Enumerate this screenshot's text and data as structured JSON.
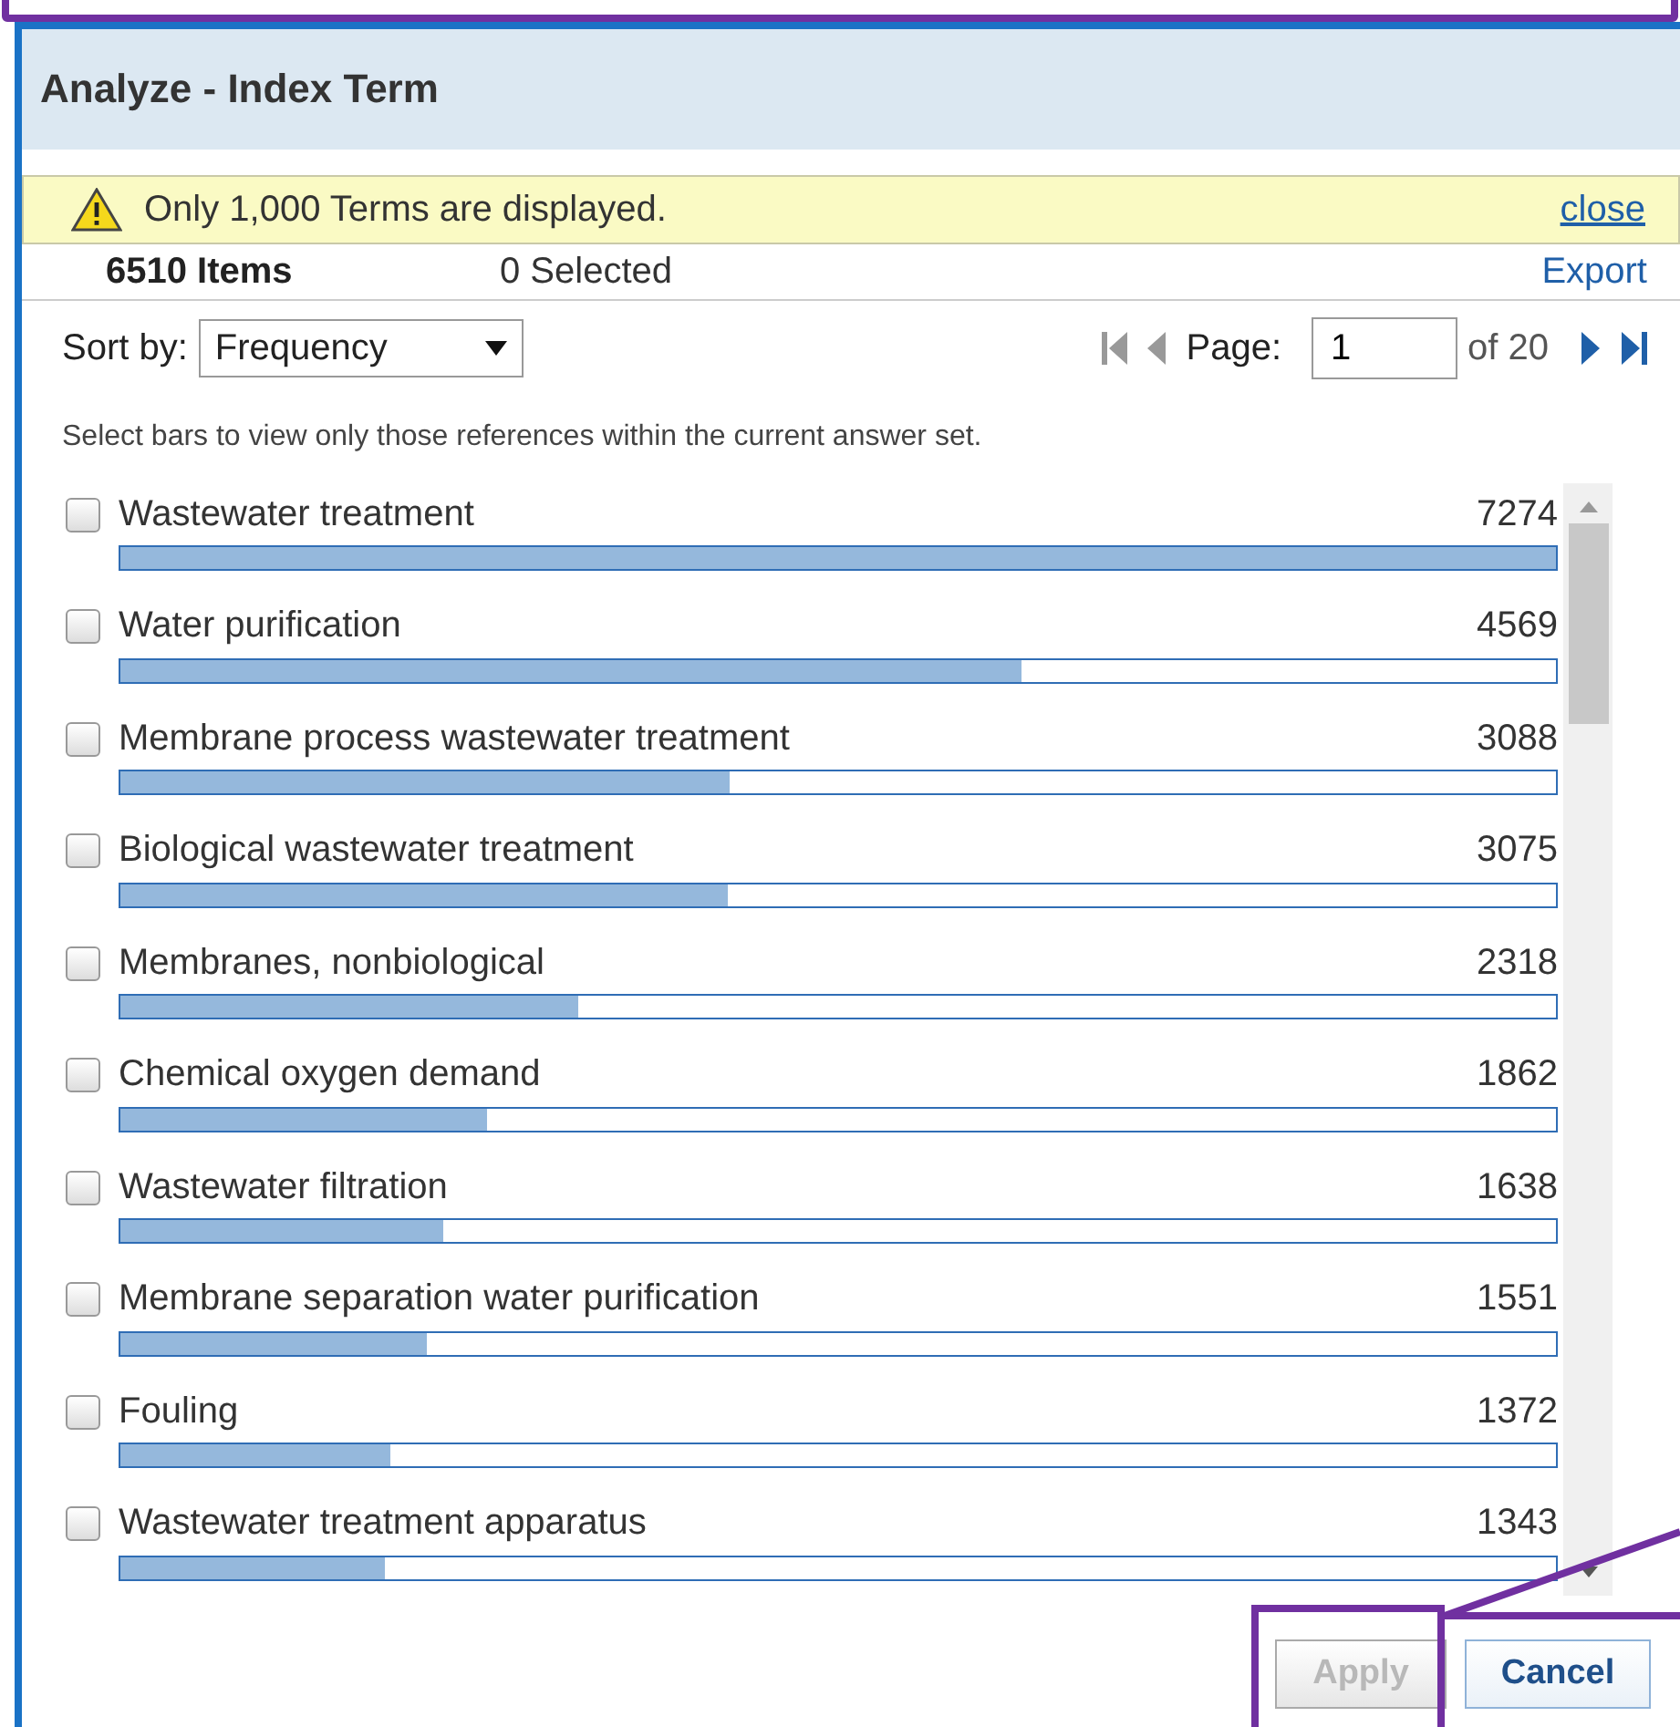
{
  "dialog": {
    "title": "Analyze - Index Term"
  },
  "notice": {
    "text": "Only 1,000 Terms are displayed.",
    "close": "close"
  },
  "summary": {
    "items": "6510 Items",
    "selected": "0 Selected",
    "export": "Export"
  },
  "sort": {
    "label": "Sort by:",
    "value": "Frequency"
  },
  "pager": {
    "label": "Page:",
    "value": "1",
    "total": "of 20"
  },
  "hint": "Select bars to view only those references within the current answer set.",
  "terms": [
    {
      "label": "Wastewater treatment",
      "count": "7274",
      "checked": false,
      "level": 1
    },
    {
      "label": "Water purification",
      "count": "4569",
      "checked": false,
      "level": 0.628
    },
    {
      "label": "Membrane process wastewater treatment",
      "count": "3088",
      "checked": false,
      "level": 0.4245
    },
    {
      "label": "Biological wastewater treatment",
      "count": "3075",
      "checked": false,
      "level": 0.4227
    },
    {
      "label": "Membranes, nonbiological",
      "count": "2318",
      "checked": false,
      "level": 0.3187
    },
    {
      "label": "Chemical oxygen demand",
      "count": "1862",
      "checked": false,
      "level": 0.256
    },
    {
      "label": "Wastewater filtration",
      "count": "1638",
      "checked": false,
      "level": 0.2252
    },
    {
      "label": "Membrane separation water purification",
      "count": "1551",
      "checked": false,
      "level": 0.2132
    },
    {
      "label": "Fouling",
      "count": "1372",
      "checked": false,
      "level": 0.1886
    },
    {
      "label": "Wastewater treatment apparatus",
      "count": "1343",
      "checked": false,
      "level": 0.1846
    }
  ],
  "buttons": [
    {
      "label": "Apply",
      "disabled": true
    },
    {
      "label": "Cancel",
      "disabled": false
    }
  ]
}
